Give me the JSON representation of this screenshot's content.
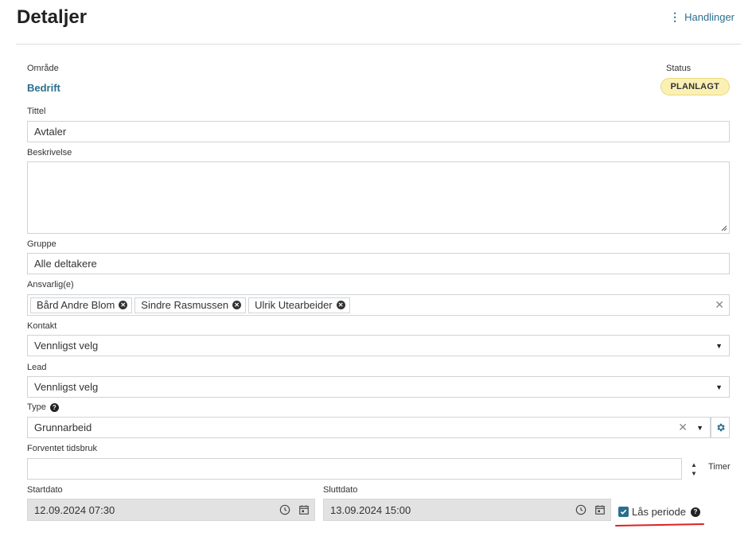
{
  "header": {
    "title": "Detaljer",
    "actions_label": "Handlinger"
  },
  "area": {
    "label": "Område",
    "value": "Bedrift"
  },
  "status": {
    "label": "Status",
    "value": "PLANLAGT"
  },
  "title_field": {
    "label": "Tittel",
    "value": "Avtaler"
  },
  "description": {
    "label": "Beskrivelse",
    "value": ""
  },
  "group": {
    "label": "Gruppe",
    "value": "Alle deltakere"
  },
  "responsible": {
    "label": "Ansvarlig(e)",
    "chips": [
      "Bård Andre Blom",
      "Sindre Rasmussen",
      "Ulrik Utearbeider"
    ]
  },
  "contact": {
    "label": "Kontakt",
    "value": "Vennligst velg"
  },
  "lead": {
    "label": "Lead",
    "value": "Vennligst velg"
  },
  "type": {
    "label": "Type",
    "value": "Grunnarbeid"
  },
  "expected_time": {
    "label": "Forventet tidsbruk",
    "value": "",
    "unit": "Timer"
  },
  "start_date": {
    "label": "Startdato",
    "value": "12.09.2024 07:30"
  },
  "end_date": {
    "label": "Sluttdato",
    "value": "13.09.2024 15:00"
  },
  "lock_period": {
    "label": "Lås periode",
    "checked": true
  },
  "colors": {
    "accent": "#2b6f8e",
    "badge_bg": "#fbf0b4",
    "annotation": "#e02020"
  },
  "icons": [
    "kebab-icon",
    "remove-icon",
    "clear-icon",
    "chevron-down-icon",
    "gear-icon",
    "spinner-up-icon",
    "spinner-down-icon",
    "clock-icon",
    "calendar-icon",
    "help-icon",
    "check-icon"
  ]
}
